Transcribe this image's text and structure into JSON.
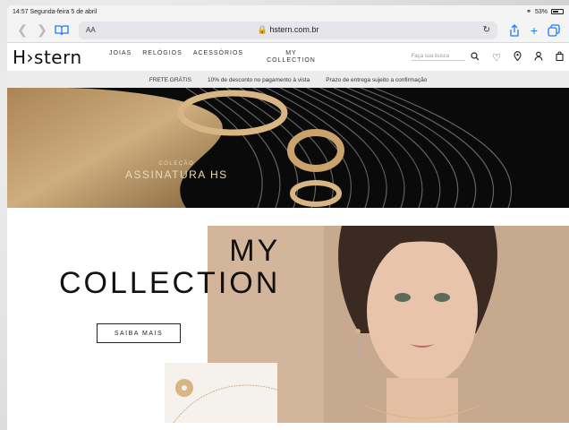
{
  "status_bar": {
    "time": "14:57",
    "date": "Segunda-feira 5 de abril",
    "battery": "53%"
  },
  "browser": {
    "aa_label": "AA",
    "url": "hstern.com.br"
  },
  "header": {
    "logo": "H›stern",
    "nav": [
      {
        "label": "JOIAS"
      },
      {
        "label": "RELÓGIOS"
      },
      {
        "label": "ACESSÓRIOS"
      }
    ],
    "my_collection_line1": "MY",
    "my_collection_line2": "COLLECTION",
    "search_placeholder": "Faça sua busca"
  },
  "promo": [
    {
      "text": "FRETE GRÁTIS"
    },
    {
      "text": "10% de desconto no pagamento à vista"
    },
    {
      "text": "Prazo de entrega sujeito a confirmação"
    }
  ],
  "hero": {
    "eyebrow": "COLEÇÃO",
    "title": "ASSINATURA HS"
  },
  "collection": {
    "title_line1": "MY",
    "title_line2": "COLLECTION",
    "cta": "SAIBA MAIS"
  }
}
